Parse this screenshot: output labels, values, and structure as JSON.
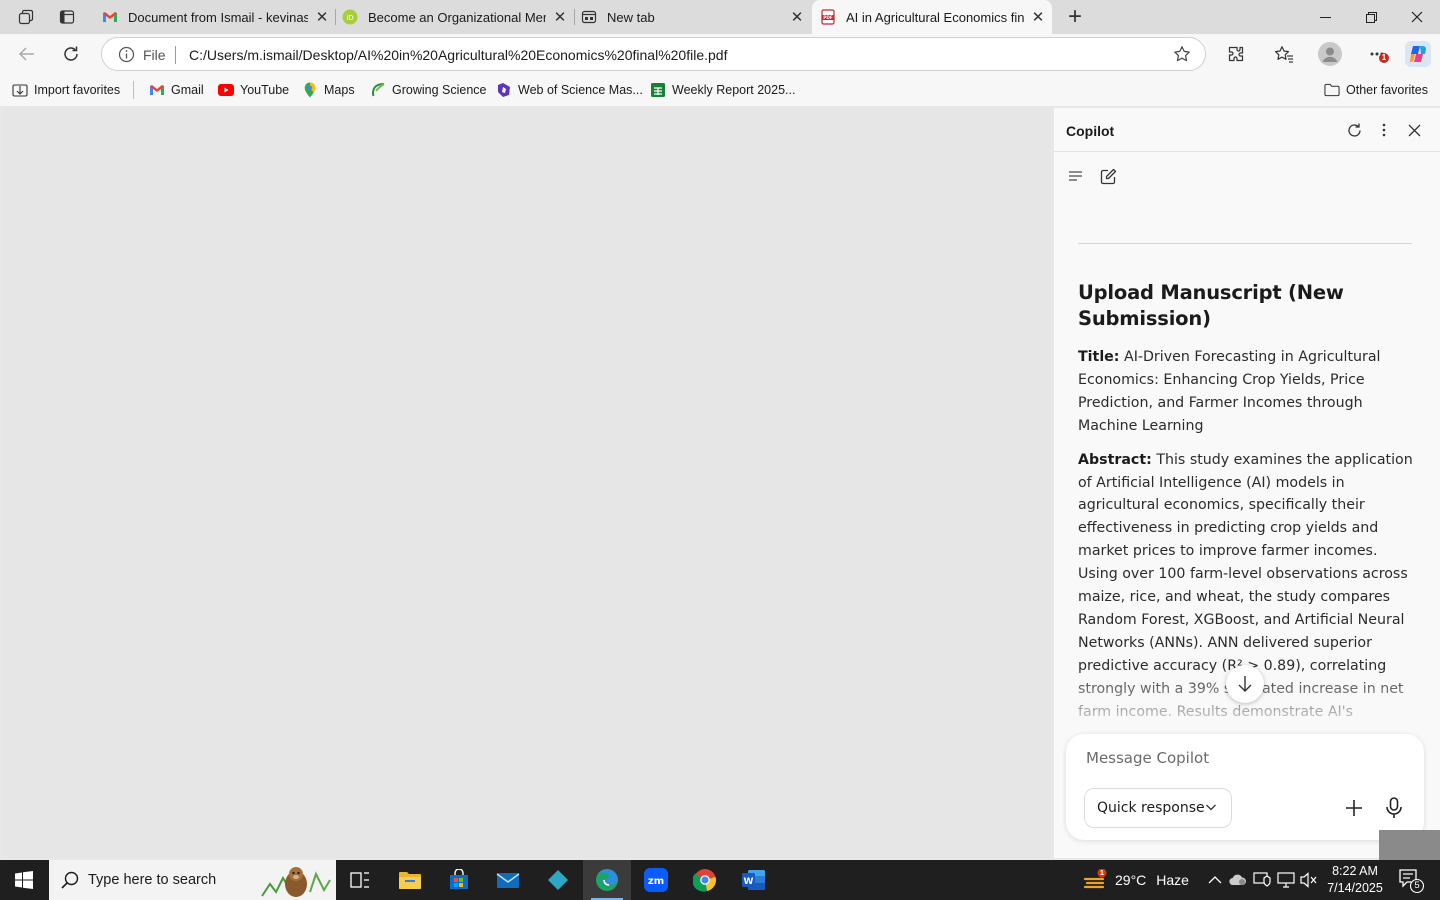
{
  "tabs": [
    {
      "title": "Document from Ismail - kevinasuf",
      "icon": "gmail-icon",
      "close": "✕"
    },
    {
      "title": "Become an Organizational Memb",
      "icon": "id-icon",
      "close": "✕"
    },
    {
      "title": "New tab",
      "icon": "newtab-icon",
      "close": "✕"
    },
    {
      "title": "AI in Agricultural Economics final",
      "icon": "pdf-icon",
      "close": "✕",
      "active": true
    }
  ],
  "address_bar": {
    "scheme": "File",
    "url": "C:/Users/m.ismail/Desktop/AI%20in%20Agricultural%20Economics%20final%20file.pdf"
  },
  "toolbar": {
    "notification_badge": "1"
  },
  "bookmarks": {
    "items": [
      {
        "label": "Import favorites",
        "icon": "import-icon"
      },
      {
        "label": "Gmail",
        "icon": "gmail-icon"
      },
      {
        "label": "YouTube",
        "icon": "youtube-icon"
      },
      {
        "label": "Maps",
        "icon": "maps-pin-icon"
      },
      {
        "label": "Growing Science",
        "icon": "growing-science-icon"
      },
      {
        "label": "Web of Science Mas...",
        "icon": "web-of-science-icon"
      },
      {
        "label": "Weekly Report 2025...",
        "icon": "sheets-icon"
      }
    ],
    "other": "Other favorites"
  },
  "copilot": {
    "title": "Copilot",
    "heading": "Upload Manuscript (New Submission)",
    "title_label": "Title:",
    "title_text": " AI-Driven Forecasting in Agricultural Economics: Enhancing Crop Yields, Price Prediction, and Farmer Incomes through Machine Learning",
    "abstract_label": "Abstract:",
    "abstract_text": " This study examines the application of Artificial Intelligence (AI) models in agricultural economics, specifically their effectiveness in predicting crop yields and market prices to improve farmer incomes. Using over 100 farm-level observations across maize, rice, and wheat, the study compares Random Forest, XGBoost, and Artificial Neural Networks (ANNs). ANN delivered superior predictive accuracy (R² > 0.89), correlating strongly with a 39% simulated increase in net farm income. Results demonstrate AI's transformative potential in",
    "input_placeholder": "Message Copilot",
    "mode": "Quick response"
  },
  "taskbar": {
    "search_placeholder": "Type here to search",
    "weather": {
      "temp": "29°C",
      "condition": "Haze",
      "alert_count": "1"
    },
    "clock": {
      "time": "8:22 AM",
      "date": "7/14/2025"
    },
    "notification_count": "5"
  },
  "colors": {
    "tabstrip": "#dcdcdc",
    "toolbar": "#f7f7f7",
    "taskbar": "#1f1f1f",
    "accent": "#0078d4"
  }
}
